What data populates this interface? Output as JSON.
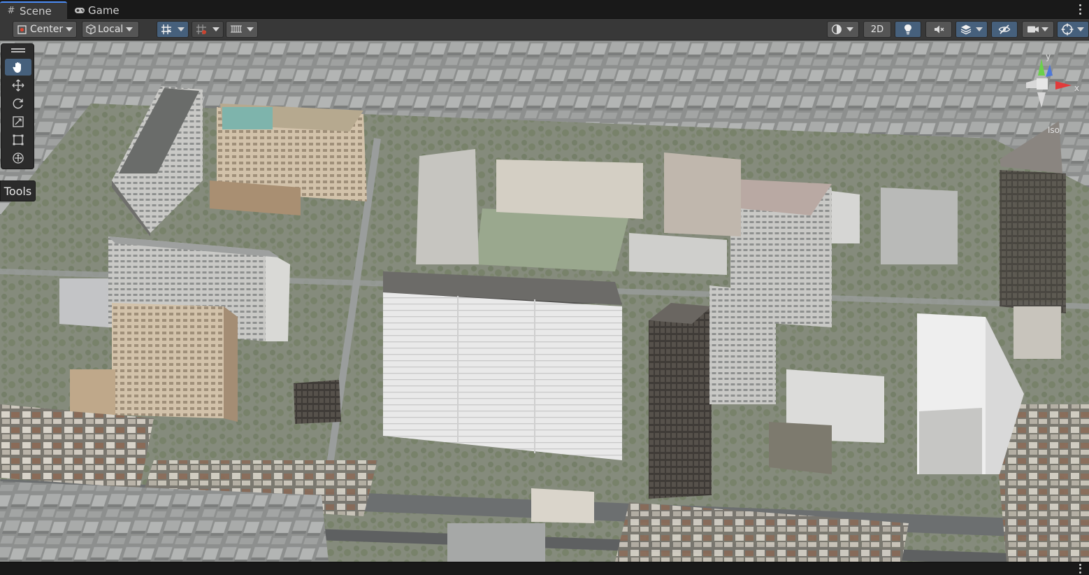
{
  "tabs": [
    {
      "label": "Scene",
      "icon": "hash-icon",
      "active": true
    },
    {
      "label": "Game",
      "icon": "gamepad-icon",
      "active": false
    }
  ],
  "toolbar": {
    "pivot_label": "Center",
    "space_label": "Local",
    "mode_2d_label": "2D"
  },
  "tools_panel": {
    "label": "Tools",
    "items": [
      "hand-tool",
      "move-tool",
      "rotate-tool",
      "scale-tool",
      "rect-tool",
      "transform-tool"
    ]
  },
  "gizmo": {
    "axes": [
      "y",
      "x"
    ],
    "projection_label": "Iso"
  },
  "colors": {
    "accent": "#46607c",
    "tab_highlight": "#4c8cf5",
    "toolbar_bg": "#383838",
    "tabbar_bg": "#191919",
    "axis_y": "#6ad14b",
    "axis_x": "#e23b3b"
  }
}
